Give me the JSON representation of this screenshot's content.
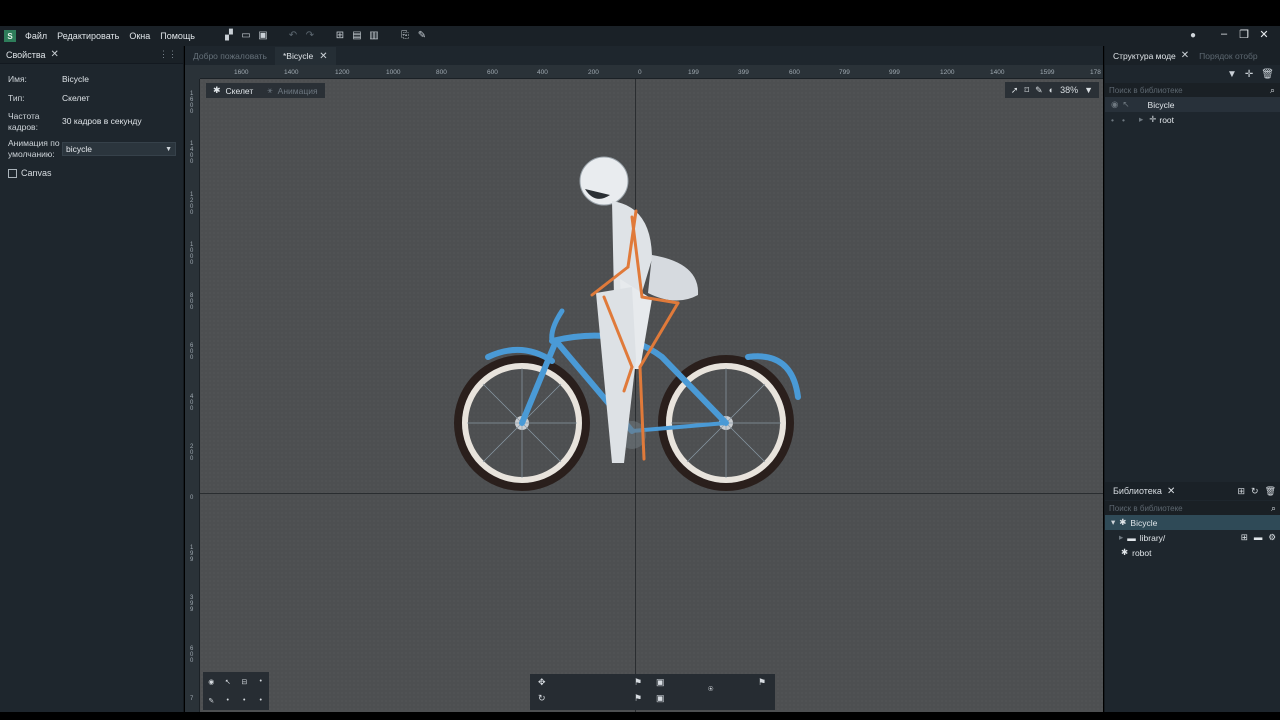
{
  "menu": {
    "file": "Файл",
    "edit": "Редактировать",
    "windows": "Окна",
    "help": "Помощь"
  },
  "properties": {
    "title": "Свойства",
    "name_label": "Имя:",
    "name_value": "Bicycle",
    "type_label": "Тип:",
    "type_value": "Скелет",
    "fps_label": "Частота кадров:",
    "fps_value": "30 кадров в секунду",
    "default_anim_label": "Анимация по умолчанию:",
    "default_anim_value": "bicycle",
    "canvas_label": "Canvas"
  },
  "doc_tabs": {
    "welcome": "Добро пожаловать",
    "bicycle": "*Bicycle"
  },
  "mode_tabs": {
    "skeleton": "Скелет",
    "animation": "Анимация"
  },
  "view": {
    "zoom": "38%"
  },
  "ruler": {
    "h_labels": [
      "1600",
      "1400",
      "1200",
      "1000",
      "800",
      "600",
      "400",
      "200",
      "0",
      "199",
      "399",
      "600",
      "799",
      "999",
      "1200",
      "1400",
      "1599",
      "178"
    ],
    "v_labels": [
      "1600",
      "1400",
      "1200",
      "1000",
      "800",
      "600",
      "400",
      "200",
      "0",
      "199",
      "399",
      "600",
      "7"
    ]
  },
  "structure": {
    "tab": "Структура моде",
    "tab2": "Порядок отобр",
    "search_placeholder": "Поиск в библиотеке",
    "root_item": "Bicycle",
    "child_item": "root"
  },
  "library": {
    "title": "Библиотека",
    "search_placeholder": "Поиск в библиотеке",
    "items": [
      "Bicycle",
      "library/",
      "robot"
    ]
  },
  "colors": {
    "bg_dark": "#1e262d",
    "canvas": "#4d4f51",
    "bike_blue": "#4a9ad6",
    "bone_orange": "#e07a3a"
  }
}
